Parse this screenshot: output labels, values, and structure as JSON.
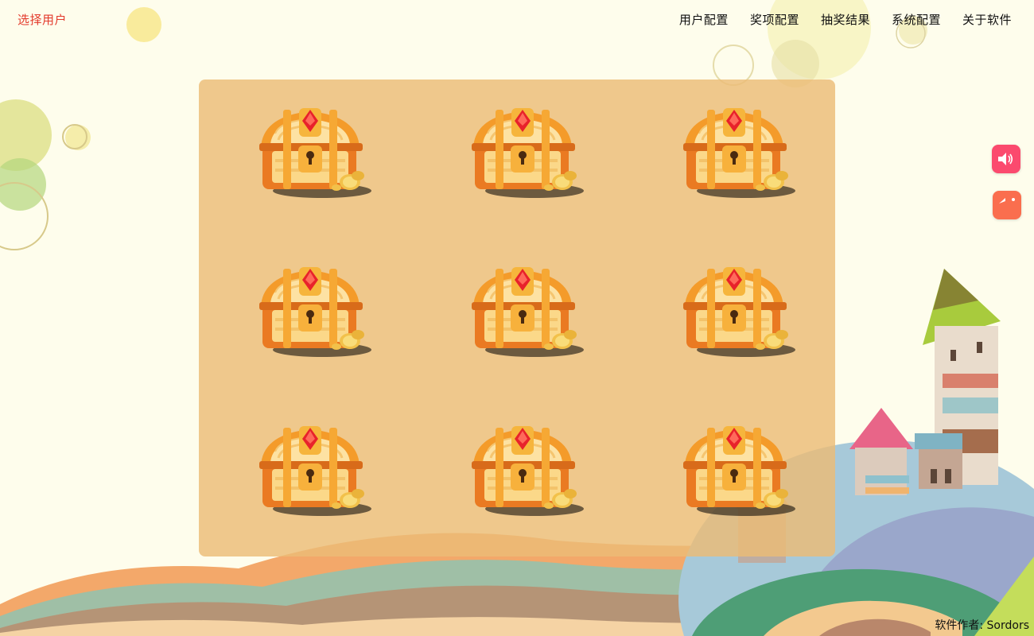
{
  "header": {
    "select_user": "选择用户",
    "nav": [
      "用户配置",
      "奖项配置",
      "抽奖结果",
      "系统配置",
      "关于软件"
    ]
  },
  "board": {
    "chest_count": 9,
    "chest_icon": "treasure-chest-icon"
  },
  "side_buttons": {
    "sound_icon": "speaker-icon",
    "back_icon": "undo-arrow-icon"
  },
  "footer": {
    "author": "软件作者: Sordors"
  },
  "colors": {
    "accent_red": "#e33a2b",
    "board": "#ecbc76",
    "sound_btn": "#fb4a6e",
    "back_btn": "#fa6e4e",
    "page_bg": "#fefdec"
  }
}
